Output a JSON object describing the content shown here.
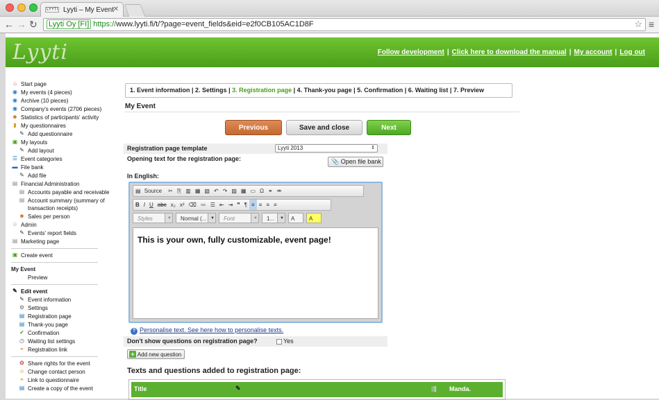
{
  "browser": {
    "tab_title": "Lyyti – My Event",
    "tab_favicon": "LYYTI",
    "ev_badge": "Lyyti Oy [FI]",
    "url_scheme": "https://",
    "url_rest": "www.lyyti.fi/t/?page=event_fields&eid=e2f0CB105AC1D8F"
  },
  "header": {
    "logo": "Lyyti",
    "links": [
      "Follow development",
      "Click here to download the manual",
      "My account",
      "Log out"
    ],
    "accent": "#5cb030"
  },
  "sidebar": {
    "items": [
      {
        "label": "Start page",
        "icon": "house-icon",
        "sub": false
      },
      {
        "label": "My events (4 pieces)",
        "icon": "globe-icon",
        "sub": false
      },
      {
        "label": "Archive (10 pieces)",
        "icon": "globe-icon",
        "sub": false
      },
      {
        "label": "Company's events (2706 pieces)",
        "icon": "globe-icon",
        "sub": false
      },
      {
        "label": "Statistics of participants' activity",
        "icon": "people-icon",
        "sub": false
      },
      {
        "label": "My questionnaires",
        "icon": "chart-icon",
        "sub": false
      },
      {
        "label": "Add questionnaire",
        "icon": "pencil-icon",
        "sub": true
      },
      {
        "label": "My layouts",
        "icon": "layout-icon",
        "sub": false
      },
      {
        "label": "Add layout",
        "icon": "pencil-icon",
        "sub": true
      },
      {
        "label": "Event categories",
        "icon": "list-icon",
        "sub": false
      },
      {
        "label": "File bank",
        "icon": "folder-icon",
        "sub": false
      },
      {
        "label": "Add file",
        "icon": "pencil-icon",
        "sub": true
      },
      {
        "label": "Financial Administration",
        "icon": "document-icon",
        "sub": false
      },
      {
        "label": "Accounts payable and receivable",
        "icon": "document-icon",
        "sub": true
      },
      {
        "label": "Account summary (summary of transaction receipts)",
        "icon": "document-icon",
        "sub": true
      },
      {
        "label": "Sales per person",
        "icon": "people-icon",
        "sub": true
      },
      {
        "label": "Admin",
        "icon": "admin-icon",
        "sub": false
      },
      {
        "label": "Events' report fields",
        "icon": "pencil-icon",
        "sub": true
      },
      {
        "label": "Marketing page",
        "icon": "document-icon",
        "sub": false
      }
    ],
    "create_event": "Create event",
    "my_event_heading": "My Event",
    "preview": "Preview",
    "edit_event_heading": "Edit event",
    "edit_items": [
      {
        "label": "Event information",
        "icon": "pencil-icon"
      },
      {
        "label": "Settings",
        "icon": "gear-icon"
      },
      {
        "label": "Registration page",
        "icon": "form-icon"
      },
      {
        "label": "Thank-you page",
        "icon": "form-icon"
      },
      {
        "label": "Confirmation",
        "icon": "check-icon"
      },
      {
        "label": "Waiting list settings",
        "icon": "clock-icon"
      },
      {
        "label": "Registration link",
        "icon": "link-icon"
      }
    ],
    "more_items": [
      {
        "label": "Share rights for the event",
        "icon": "share-icon"
      },
      {
        "label": "Change contact person",
        "icon": "person-icon"
      },
      {
        "label": "Link to questionnaire",
        "icon": "link-icon"
      },
      {
        "label": "Create a copy of the event",
        "icon": "copy-icon"
      }
    ]
  },
  "main": {
    "steps": [
      "1. Event information",
      "2. Settings",
      "3. Registration page",
      "4. Thank-you page",
      "5. Confirmation",
      "6. Waiting list",
      "7. Preview"
    ],
    "active_step": 2,
    "page_title": "My Event",
    "buttons": {
      "previous": "Previous",
      "save_close": "Save and close",
      "next": "Next"
    },
    "template_label": "Registration page template",
    "template_value": "Lyyti 2013",
    "opening_label": "Opening text for the registration page:",
    "open_file_bank": "Open file bank",
    "lang_label": "In English:",
    "editor": {
      "source": "Source",
      "styles": "Styles",
      "format": "Normal (...",
      "font": "Font",
      "size": "1...",
      "content": "This is your own, fully customizable, event page!"
    },
    "personalise": "Personalise text. See here how to personalise texts.",
    "dont_show_label": "Don't show questions on registration page?",
    "dont_show_option": "Yes",
    "add_question": "Add new question",
    "texts_heading": "Texts and questions added to registration page:",
    "table_headers": [
      "Title",
      "Manda."
    ]
  }
}
